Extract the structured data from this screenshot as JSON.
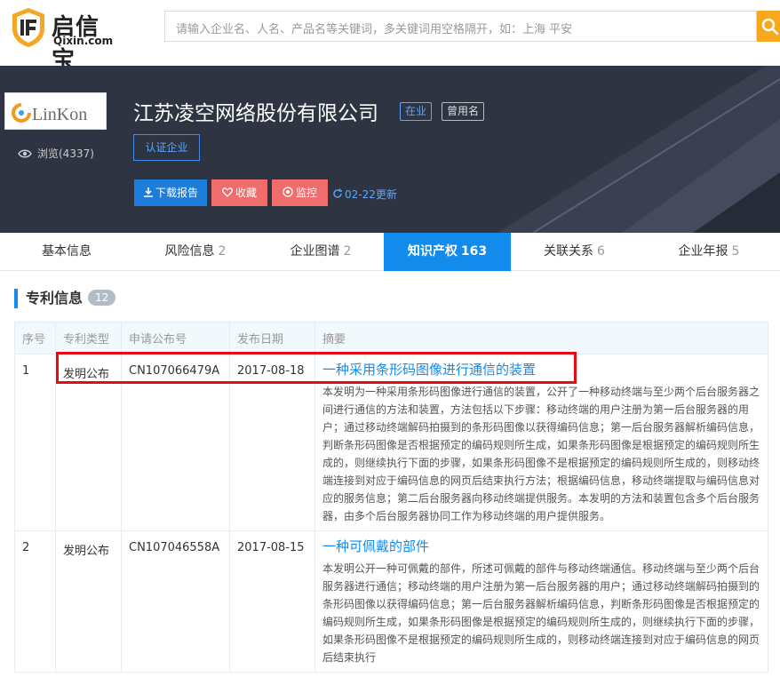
{
  "header": {
    "logo_text": "启信宝",
    "logo_sub": "Qixin.com",
    "search_placeholder": "请输入企业名、人名、产品名等关键词，多关键词用空格隔开，如：上海 平安",
    "search_icon": "search-icon"
  },
  "company": {
    "logo_text": "LinKon",
    "views_label": "浏览(4337)",
    "name": "江苏凌空网络股份有限公司",
    "status_tag": "在业",
    "former_name_tag": "曾用名",
    "verify_label": "认证企业",
    "download_label": "下载报告",
    "favorite_label": "收藏",
    "monitor_label": "监控",
    "update_label": "02-22更新"
  },
  "tabs": [
    {
      "label": "基本信息",
      "count": ""
    },
    {
      "label": "风险信息",
      "count": "2"
    },
    {
      "label": "企业图谱",
      "count": "2"
    },
    {
      "label": "知识产权",
      "count": "163"
    },
    {
      "label": "关联关系",
      "count": "6"
    },
    {
      "label": "企业年报",
      "count": "5"
    }
  ],
  "section": {
    "title": "专利信息",
    "count": "12"
  },
  "table": {
    "headers": [
      "序号",
      "专利类型",
      "申请公布号",
      "发布日期",
      "摘要"
    ],
    "rows": [
      {
        "no": "1",
        "type": "发明公布",
        "pub_no": "CN107066479A",
        "date": "2017-08-18",
        "title": "一种采用条形码图像进行通信的装置",
        "abstract": "本发明为一种采用条形码图像进行通信的装置，公开了一种移动终端与至少两个后台服务器之间进行通信的方法和装置，方法包括以下步骤：移动终端的用户注册为第一后台服务器的用户；通过移动终端解码拍摄到的条形码图像以获得编码信息；第一后台服务器解析编码信息，判断条形码图像是否根据预定的编码规则所生成，如果条形码图像是根据预定的编码规则所生成的，则继续执行下面的步骤，如果条形码图像不是根据预定的编码规则所生成的，则移动终端连接到对应于编码信息的网页后结束执行方法；根据编码信息，移动终端提取与编码信息对应的服务信息；第二后台服务器向移动终端提供服务。本发明的方法和装置包含多个后台服务器，由多个后台服务器协同工作为移动终端的用户提供服务。"
      },
      {
        "no": "2",
        "type": "发明公布",
        "pub_no": "CN107046558A",
        "date": "2017-08-15",
        "title": "一种可佩戴的部件",
        "abstract": "本发明公开一种可佩戴的部件，所述可佩戴的部件与移动终端通信。移动终端与至少两个后台服务器进行通信；移动终端的用户注册为第一后台服务器的用户；通过移动终端解码拍摄到的条形码图像以获得编码信息；第一后台服务器解析编码信息，判断条形码图像是否根据预定的编码规则所生成，如果条形码图像是根据预定的编码规则所生成的，则继续执行下面的步骤，如果条形码图像不是根据预定的编码规则所生成的，则移动终端连接到对应于编码信息的网页后结束执行"
      }
    ]
  },
  "colors": {
    "accent": "#128bed",
    "highlight_box": "#e50d13",
    "banner_bg": "#2f3443",
    "action_red": "#ef6d6d",
    "search_orange": "#f8a81f"
  }
}
